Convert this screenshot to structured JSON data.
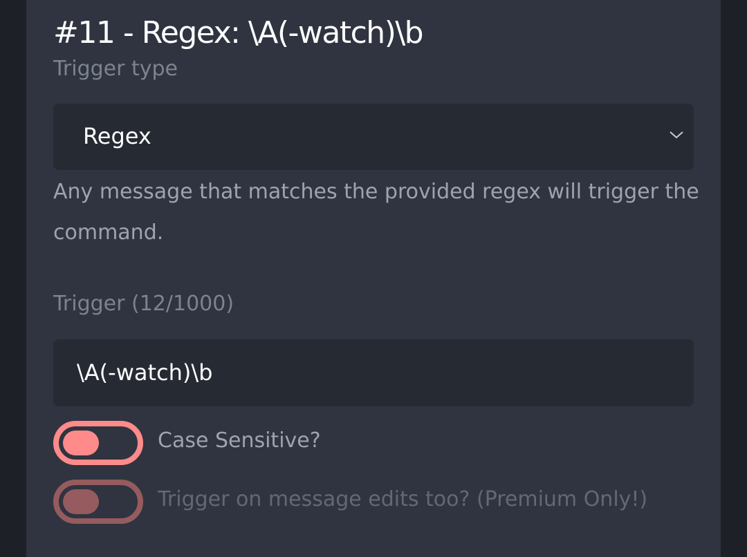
{
  "header": {
    "title": "#11 - Regex: \\A(-watch)\\b"
  },
  "trigger_type": {
    "label": "Trigger type",
    "selected": "Regex",
    "help_text": "Any message that matches the provided regex will trigger the command."
  },
  "trigger": {
    "label": "Trigger (12/1000)",
    "value": "\\A(-watch)\\b"
  },
  "toggles": [
    {
      "label": "Case Sensitive?",
      "enabled": true
    },
    {
      "label": "Trigger on message edits too? (Premium Only!)",
      "enabled": false
    }
  ],
  "colors": {
    "accent": "#ff8a8a",
    "accent_disabled": "#b86868",
    "panel": "#2f3440",
    "field": "#262a33"
  }
}
